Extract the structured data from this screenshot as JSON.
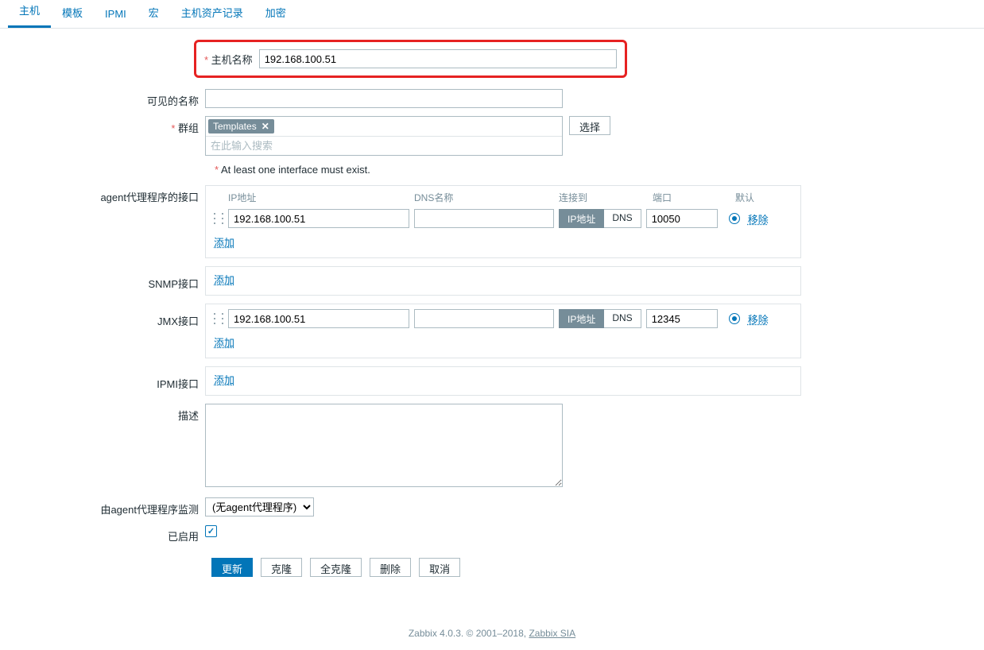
{
  "tabs": [
    "主机",
    "模板",
    "IPMI",
    "宏",
    "主机资产记录",
    "加密"
  ],
  "labels": {
    "hostname": "主机名称",
    "visible_name": "可见的名称",
    "groups": "群组",
    "select": "选择",
    "interface_warn": "At least one interface must exist.",
    "agent_if": "agent代理程序的接口",
    "snmp_if": "SNMP接口",
    "jmx_if": "JMX接口",
    "ipmi_if": "IPMI接口",
    "desc": "描述",
    "monitored_by": "由agent代理程序监测",
    "enabled": "已启用",
    "add": "添加",
    "remove": "移除"
  },
  "hostname_value": "192.168.100.51",
  "visible_name_value": "",
  "group_tag": "Templates",
  "group_search_placeholder": "在此输入搜索",
  "iface_headers": {
    "ip": "IP地址",
    "dns": "DNS名称",
    "connect": "连接到",
    "port": "端口",
    "default": "默认"
  },
  "agent_iface": {
    "ip": "192.168.100.51",
    "dns": "",
    "seg_ip": "IP地址",
    "seg_dns": "DNS",
    "port": "10050"
  },
  "jmx_iface": {
    "ip": "192.168.100.51",
    "dns": "",
    "seg_ip": "IP地址",
    "seg_dns": "DNS",
    "port": "12345"
  },
  "proxy_option": "(无agent代理程序)",
  "buttons": {
    "update": "更新",
    "clone": "克隆",
    "full_clone": "全克隆",
    "delete": "删除",
    "cancel": "取消"
  },
  "footer": {
    "text": "Zabbix 4.0.3. © 2001–2018, ",
    "link": "Zabbix SIA"
  }
}
